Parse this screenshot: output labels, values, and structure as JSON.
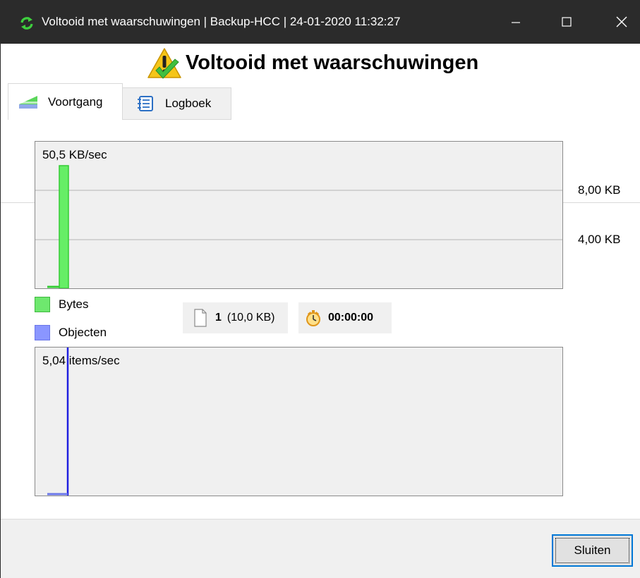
{
  "window": {
    "title": "Voltooid met waarschuwingen | Backup-HCC | 24-01-2020 11:32:27",
    "app_icon": "sync-arrows-icon",
    "controls": [
      "minimize-icon",
      "maximize-icon",
      "close-icon"
    ]
  },
  "heading": {
    "text": "Voltooid met waarschuwingen",
    "icon": "warning-check-icon"
  },
  "tabs": [
    {
      "label": "Voortgang",
      "icon": "progress-chart-icon",
      "active": true
    },
    {
      "label": "Logboek",
      "icon": "notebook-icon",
      "active": false
    }
  ],
  "bytes_chart": {
    "rate_label": "50,5 KB/sec",
    "y_labels": [
      "8,00 KB",
      "4,00 KB"
    ],
    "series_color": "#33cc33",
    "fill_color": "#66ee66"
  },
  "legend": {
    "bytes": "Bytes",
    "objects": "Objecten",
    "bytes_color": "#6ee86e",
    "objects_color": "#8a96ff"
  },
  "stats": {
    "file_count": "1",
    "file_size": "(10,0 KB)",
    "file_icon": "file-icon",
    "elapsed": "00:00:00",
    "timer_icon": "stopwatch-icon"
  },
  "objects_chart": {
    "rate_label": "5,04 items/sec",
    "series_color": "#2020e0"
  },
  "footer": {
    "close_label": "Sluiten"
  }
}
